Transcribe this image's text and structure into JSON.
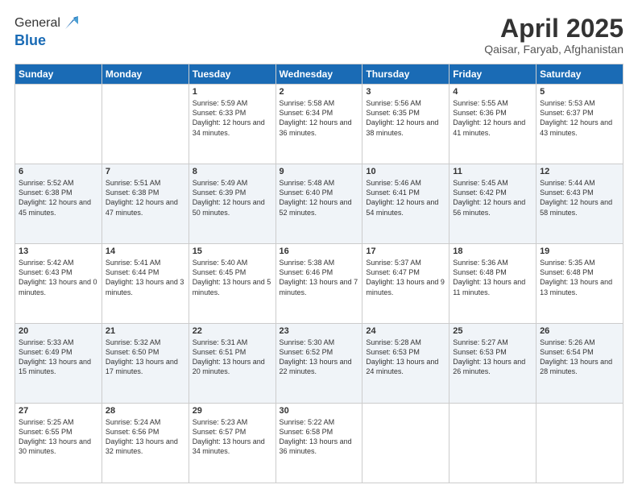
{
  "header": {
    "logo_line1": "General",
    "logo_line2": "Blue",
    "month": "April 2025",
    "location": "Qaisar, Faryab, Afghanistan"
  },
  "weekdays": [
    "Sunday",
    "Monday",
    "Tuesday",
    "Wednesday",
    "Thursday",
    "Friday",
    "Saturday"
  ],
  "weeks": [
    [
      {
        "day": "",
        "text": ""
      },
      {
        "day": "",
        "text": ""
      },
      {
        "day": "1",
        "text": "Sunrise: 5:59 AM\nSunset: 6:33 PM\nDaylight: 12 hours and 34 minutes."
      },
      {
        "day": "2",
        "text": "Sunrise: 5:58 AM\nSunset: 6:34 PM\nDaylight: 12 hours and 36 minutes."
      },
      {
        "day": "3",
        "text": "Sunrise: 5:56 AM\nSunset: 6:35 PM\nDaylight: 12 hours and 38 minutes."
      },
      {
        "day": "4",
        "text": "Sunrise: 5:55 AM\nSunset: 6:36 PM\nDaylight: 12 hours and 41 minutes."
      },
      {
        "day": "5",
        "text": "Sunrise: 5:53 AM\nSunset: 6:37 PM\nDaylight: 12 hours and 43 minutes."
      }
    ],
    [
      {
        "day": "6",
        "text": "Sunrise: 5:52 AM\nSunset: 6:38 PM\nDaylight: 12 hours and 45 minutes."
      },
      {
        "day": "7",
        "text": "Sunrise: 5:51 AM\nSunset: 6:38 PM\nDaylight: 12 hours and 47 minutes."
      },
      {
        "day": "8",
        "text": "Sunrise: 5:49 AM\nSunset: 6:39 PM\nDaylight: 12 hours and 50 minutes."
      },
      {
        "day": "9",
        "text": "Sunrise: 5:48 AM\nSunset: 6:40 PM\nDaylight: 12 hours and 52 minutes."
      },
      {
        "day": "10",
        "text": "Sunrise: 5:46 AM\nSunset: 6:41 PM\nDaylight: 12 hours and 54 minutes."
      },
      {
        "day": "11",
        "text": "Sunrise: 5:45 AM\nSunset: 6:42 PM\nDaylight: 12 hours and 56 minutes."
      },
      {
        "day": "12",
        "text": "Sunrise: 5:44 AM\nSunset: 6:43 PM\nDaylight: 12 hours and 58 minutes."
      }
    ],
    [
      {
        "day": "13",
        "text": "Sunrise: 5:42 AM\nSunset: 6:43 PM\nDaylight: 13 hours and 0 minutes."
      },
      {
        "day": "14",
        "text": "Sunrise: 5:41 AM\nSunset: 6:44 PM\nDaylight: 13 hours and 3 minutes."
      },
      {
        "day": "15",
        "text": "Sunrise: 5:40 AM\nSunset: 6:45 PM\nDaylight: 13 hours and 5 minutes."
      },
      {
        "day": "16",
        "text": "Sunrise: 5:38 AM\nSunset: 6:46 PM\nDaylight: 13 hours and 7 minutes."
      },
      {
        "day": "17",
        "text": "Sunrise: 5:37 AM\nSunset: 6:47 PM\nDaylight: 13 hours and 9 minutes."
      },
      {
        "day": "18",
        "text": "Sunrise: 5:36 AM\nSunset: 6:48 PM\nDaylight: 13 hours and 11 minutes."
      },
      {
        "day": "19",
        "text": "Sunrise: 5:35 AM\nSunset: 6:48 PM\nDaylight: 13 hours and 13 minutes."
      }
    ],
    [
      {
        "day": "20",
        "text": "Sunrise: 5:33 AM\nSunset: 6:49 PM\nDaylight: 13 hours and 15 minutes."
      },
      {
        "day": "21",
        "text": "Sunrise: 5:32 AM\nSunset: 6:50 PM\nDaylight: 13 hours and 17 minutes."
      },
      {
        "day": "22",
        "text": "Sunrise: 5:31 AM\nSunset: 6:51 PM\nDaylight: 13 hours and 20 minutes."
      },
      {
        "day": "23",
        "text": "Sunrise: 5:30 AM\nSunset: 6:52 PM\nDaylight: 13 hours and 22 minutes."
      },
      {
        "day": "24",
        "text": "Sunrise: 5:28 AM\nSunset: 6:53 PM\nDaylight: 13 hours and 24 minutes."
      },
      {
        "day": "25",
        "text": "Sunrise: 5:27 AM\nSunset: 6:53 PM\nDaylight: 13 hours and 26 minutes."
      },
      {
        "day": "26",
        "text": "Sunrise: 5:26 AM\nSunset: 6:54 PM\nDaylight: 13 hours and 28 minutes."
      }
    ],
    [
      {
        "day": "27",
        "text": "Sunrise: 5:25 AM\nSunset: 6:55 PM\nDaylight: 13 hours and 30 minutes."
      },
      {
        "day": "28",
        "text": "Sunrise: 5:24 AM\nSunset: 6:56 PM\nDaylight: 13 hours and 32 minutes."
      },
      {
        "day": "29",
        "text": "Sunrise: 5:23 AM\nSunset: 6:57 PM\nDaylight: 13 hours and 34 minutes."
      },
      {
        "day": "30",
        "text": "Sunrise: 5:22 AM\nSunset: 6:58 PM\nDaylight: 13 hours and 36 minutes."
      },
      {
        "day": "",
        "text": ""
      },
      {
        "day": "",
        "text": ""
      },
      {
        "day": "",
        "text": ""
      }
    ]
  ]
}
